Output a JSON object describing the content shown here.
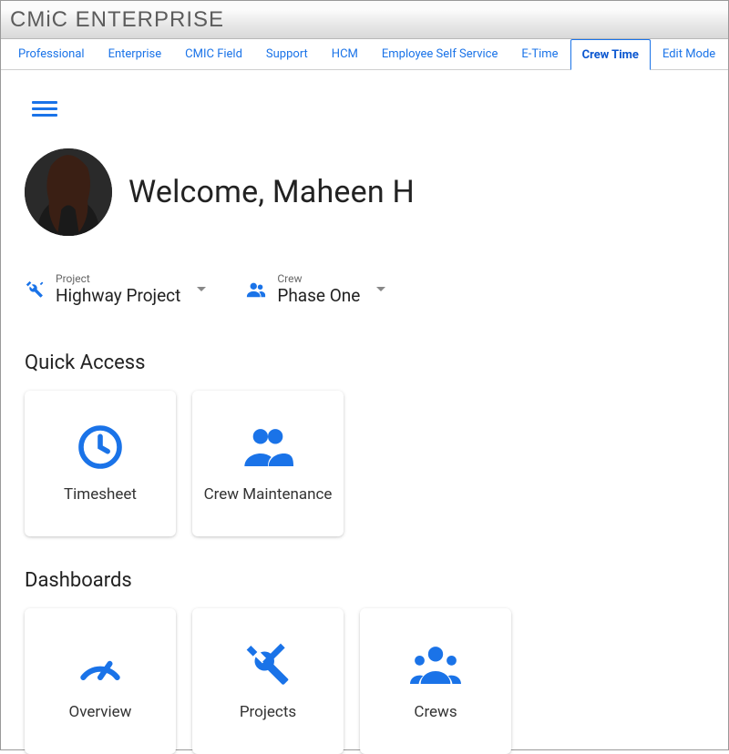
{
  "app_title": "CMiC ENTERPRISE",
  "nav": [
    {
      "label": "Professional",
      "active": false
    },
    {
      "label": "Enterprise",
      "active": false
    },
    {
      "label": "CMIC Field",
      "active": false
    },
    {
      "label": "Support",
      "active": false
    },
    {
      "label": "HCM",
      "active": false
    },
    {
      "label": "Employee Self Service",
      "active": false
    },
    {
      "label": "E-Time",
      "active": false
    },
    {
      "label": "Crew Time",
      "active": true
    },
    {
      "label": "Edit Mode",
      "active": false
    }
  ],
  "welcome": "Welcome, Maheen H",
  "selectors": {
    "project": {
      "label": "Project",
      "value": "Highway Project"
    },
    "crew": {
      "label": "Crew",
      "value": "Phase One"
    }
  },
  "sections": {
    "quick_access": {
      "title": "Quick Access",
      "cards": [
        {
          "label": "Timesheet",
          "icon": "clock"
        },
        {
          "label": "Crew Maintenance",
          "icon": "people"
        }
      ]
    },
    "dashboards": {
      "title": "Dashboards",
      "cards": [
        {
          "label": "Overview",
          "icon": "gauge"
        },
        {
          "label": "Projects",
          "icon": "tools"
        },
        {
          "label": "Crews",
          "icon": "groups"
        }
      ]
    }
  },
  "colors": {
    "accent": "#1a73e8"
  }
}
